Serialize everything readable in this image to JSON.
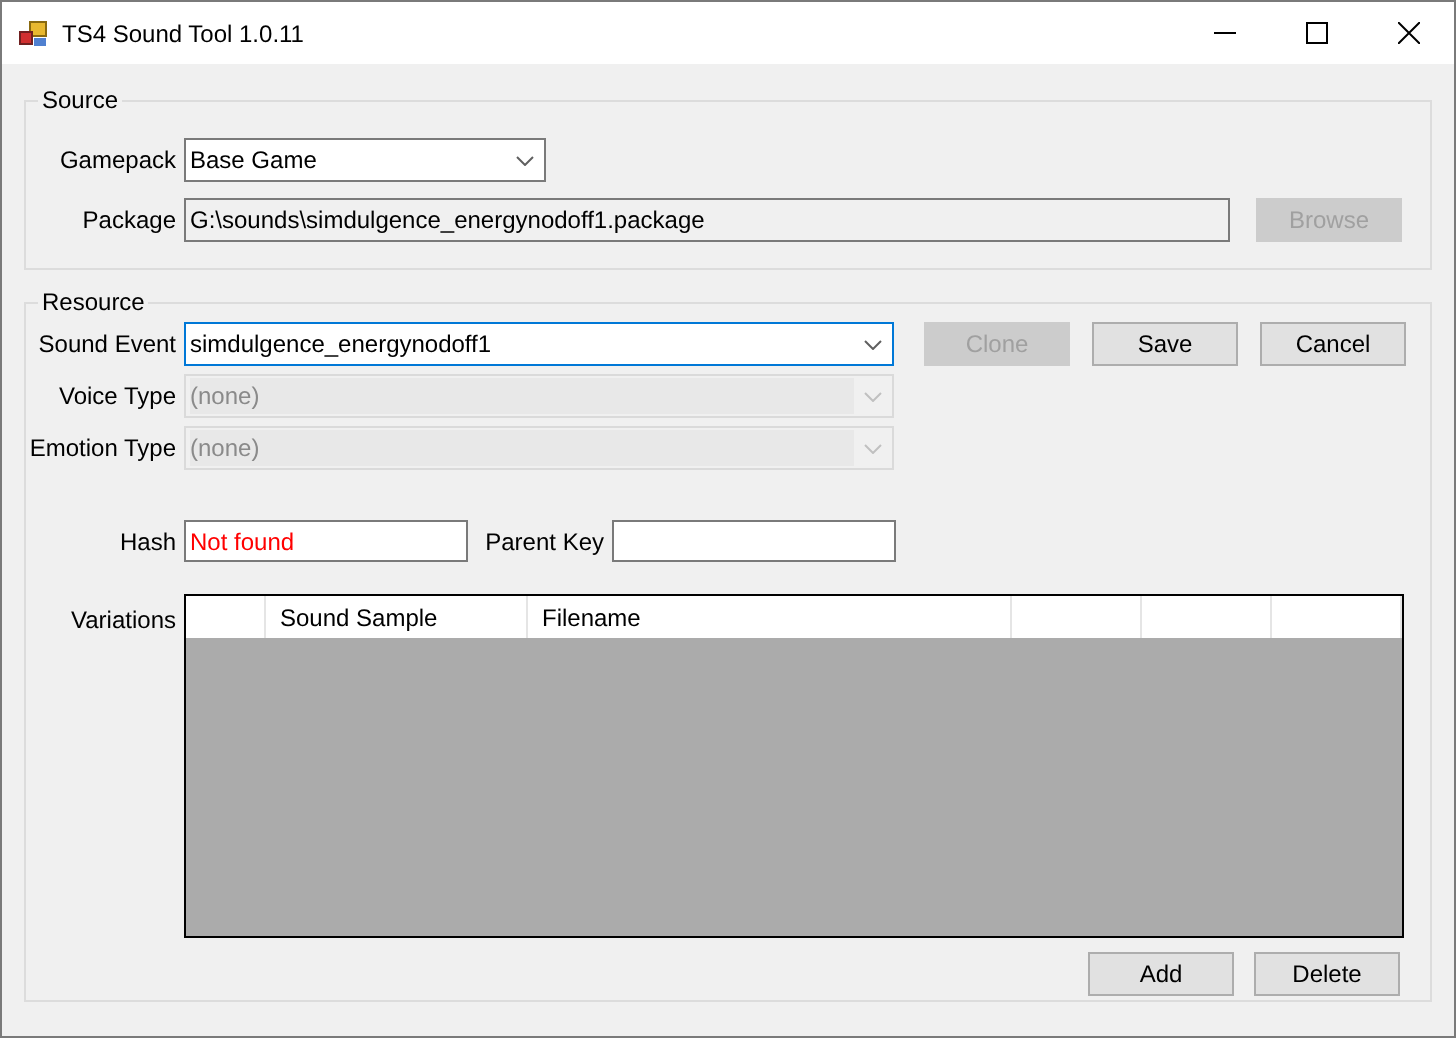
{
  "window": {
    "title": "TS4 Sound Tool 1.0.11"
  },
  "source": {
    "title": "Source",
    "gamepack": {
      "label": "Gamepack",
      "value": "Base Game",
      "disabled": false,
      "focused": false
    },
    "package": {
      "label": "Package",
      "value": "G:\\sounds\\simdulgence_energynodoff1.package"
    },
    "browse": {
      "label": "Browse",
      "disabled": true
    }
  },
  "resource": {
    "title": "Resource",
    "sound_event": {
      "label": "Sound Event",
      "value": "simdulgence_energynodoff1",
      "disabled": false,
      "focused": true
    },
    "voice_type": {
      "label": "Voice Type",
      "value": "(none)",
      "disabled": true,
      "focused": false
    },
    "emotion_type": {
      "label": "Emotion Type",
      "value": "(none)",
      "disabled": true,
      "focused": false
    },
    "actions": [
      {
        "label": "Clone",
        "disabled": true
      },
      {
        "label": "Save",
        "disabled": false
      },
      {
        "label": "Cancel",
        "disabled": false
      }
    ],
    "hash": {
      "label": "Hash",
      "value": "Not found",
      "error": true
    },
    "parent_key": {
      "label": "Parent Key"
    },
    "variations": {
      "label": "Variations",
      "columns": [
        "",
        "Sound Sample",
        "Filename",
        "",
        "",
        ""
      ]
    },
    "buttons": [
      {
        "label": "Add",
        "disabled": false
      },
      {
        "label": "Delete",
        "disabled": false
      }
    ]
  }
}
